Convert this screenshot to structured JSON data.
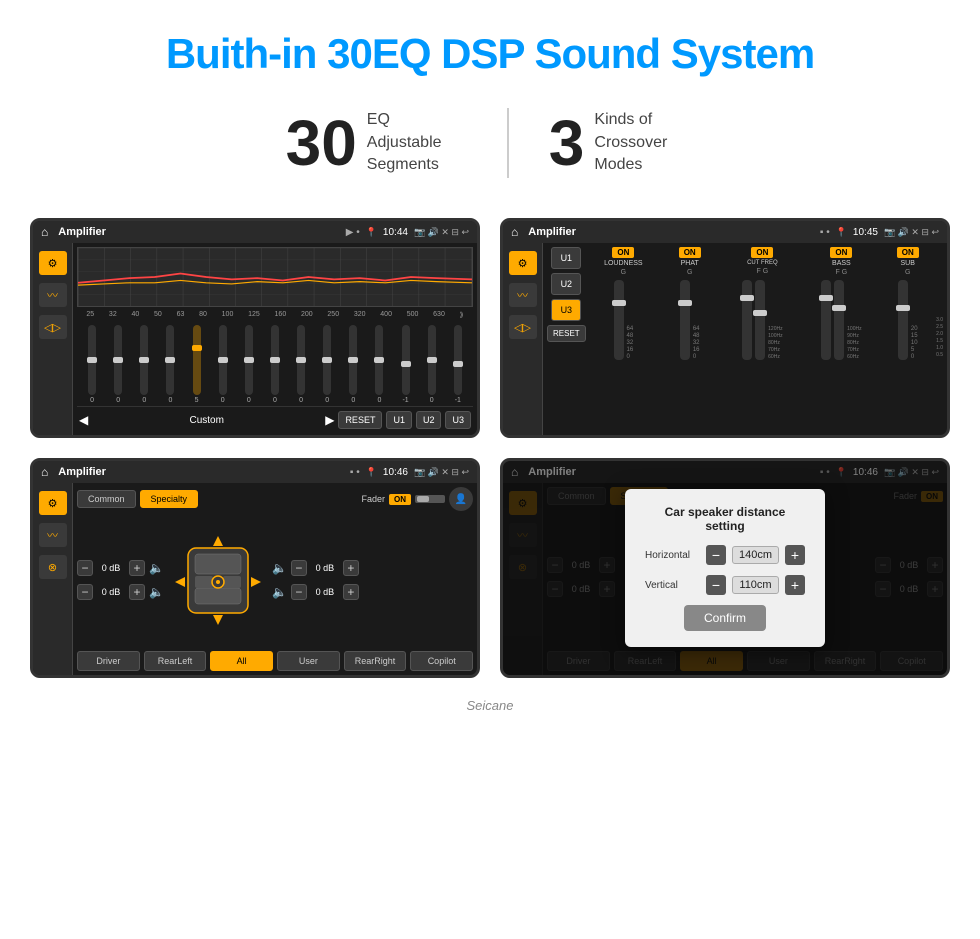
{
  "header": {
    "title": "Buith-in 30EQ DSP Sound System"
  },
  "stats": [
    {
      "number": "30",
      "desc": "EQ Adjustable\nSegments"
    },
    {
      "number": "3",
      "desc": "Kinds of\nCrossover Modes"
    }
  ],
  "screens": [
    {
      "id": "eq-screen",
      "title": "Amplifier",
      "time": "10:44",
      "type": "eq",
      "frequencies": [
        "25",
        "32",
        "40",
        "50",
        "63",
        "80",
        "100",
        "125",
        "160",
        "200",
        "250",
        "320",
        "400",
        "500",
        "630"
      ],
      "values": [
        "0",
        "0",
        "0",
        "0",
        "5",
        "0",
        "0",
        "0",
        "0",
        "0",
        "0",
        "0",
        "-1",
        "0",
        "-1"
      ],
      "sliderPositions": [
        50,
        50,
        50,
        50,
        60,
        50,
        50,
        50,
        50,
        50,
        50,
        50,
        45,
        50,
        45
      ],
      "preset": "Custom",
      "buttons": [
        "RESET",
        "U1",
        "U2",
        "U3"
      ]
    },
    {
      "id": "crossover-screen",
      "title": "Amplifier",
      "time": "10:45",
      "type": "crossover",
      "presets": [
        "U1",
        "U2",
        "U3"
      ],
      "activePreset": "U3",
      "channels": [
        {
          "name": "LOUDNESS",
          "on": true,
          "labels": [
            "G"
          ]
        },
        {
          "name": "PHAT",
          "on": true,
          "labels": [
            "G"
          ]
        },
        {
          "name": "CUT FREQ",
          "on": true,
          "labels": [
            "F",
            "G"
          ]
        },
        {
          "name": "BASS",
          "on": true,
          "labels": [
            "F",
            "G"
          ]
        },
        {
          "name": "SUB",
          "on": true,
          "labels": [
            "G"
          ]
        }
      ]
    },
    {
      "id": "specialty-screen",
      "title": "Amplifier",
      "time": "10:46",
      "type": "specialty",
      "tabs": [
        "Common",
        "Specialty"
      ],
      "activeTab": "Specialty",
      "fader": {
        "label": "Fader",
        "on": true
      },
      "volumes": [
        {
          "left": {
            "val": "0 dB"
          },
          "right": {
            "val": "0 dB"
          }
        },
        {
          "left": {
            "val": "0 dB"
          },
          "right": {
            "val": "0 dB"
          }
        }
      ],
      "speakerBtns": [
        "Driver",
        "RearLeft",
        "All",
        "User",
        "RearRight",
        "Copilot"
      ]
    },
    {
      "id": "distance-screen",
      "title": "Amplifier",
      "time": "10:46",
      "type": "distance",
      "tabs": [
        "Common",
        "Specialty"
      ],
      "activeTab": "Specialty",
      "dialog": {
        "title": "Car speaker distance setting",
        "fields": [
          {
            "label": "Horizontal",
            "value": "140cm"
          },
          {
            "label": "Vertical",
            "value": "110cm"
          }
        ],
        "confirmLabel": "Confirm"
      }
    }
  ],
  "watermark": "Seicane"
}
